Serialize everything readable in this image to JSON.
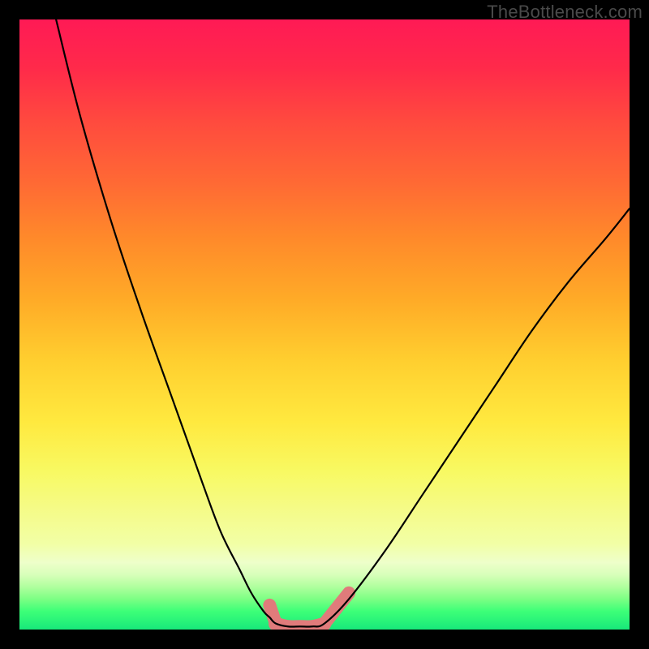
{
  "watermark": "TheBottleneck.com",
  "colors": {
    "frame": "#000000",
    "curve": "#000000",
    "flat_marker": "#e07b7b"
  },
  "chart_data": {
    "type": "line",
    "title": "",
    "xlabel": "",
    "ylabel": "",
    "xlim": [
      0,
      100
    ],
    "ylim": [
      0,
      100
    ],
    "series": [
      {
        "name": "left-branch",
        "x": [
          6,
          10,
          15,
          20,
          25,
          30,
          33,
          36,
          38,
          40,
          41,
          42
        ],
        "y": [
          100,
          84,
          67,
          52,
          38,
          24,
          16,
          10,
          6,
          3,
          2,
          1
        ]
      },
      {
        "name": "flat-minimum",
        "x": [
          42,
          44,
          46,
          48,
          50
        ],
        "y": [
          1,
          0.5,
          0.5,
          0.5,
          1
        ]
      },
      {
        "name": "right-branch",
        "x": [
          50,
          54,
          60,
          66,
          72,
          78,
          84,
          90,
          96,
          100
        ],
        "y": [
          1,
          5,
          13,
          22,
          31,
          40,
          49,
          57,
          64,
          69
        ]
      }
    ],
    "annotations": [
      {
        "name": "flat-region-highlight",
        "x_range": [
          40,
          51
        ],
        "note": "pink rounded marker over valley floor"
      }
    ]
  }
}
